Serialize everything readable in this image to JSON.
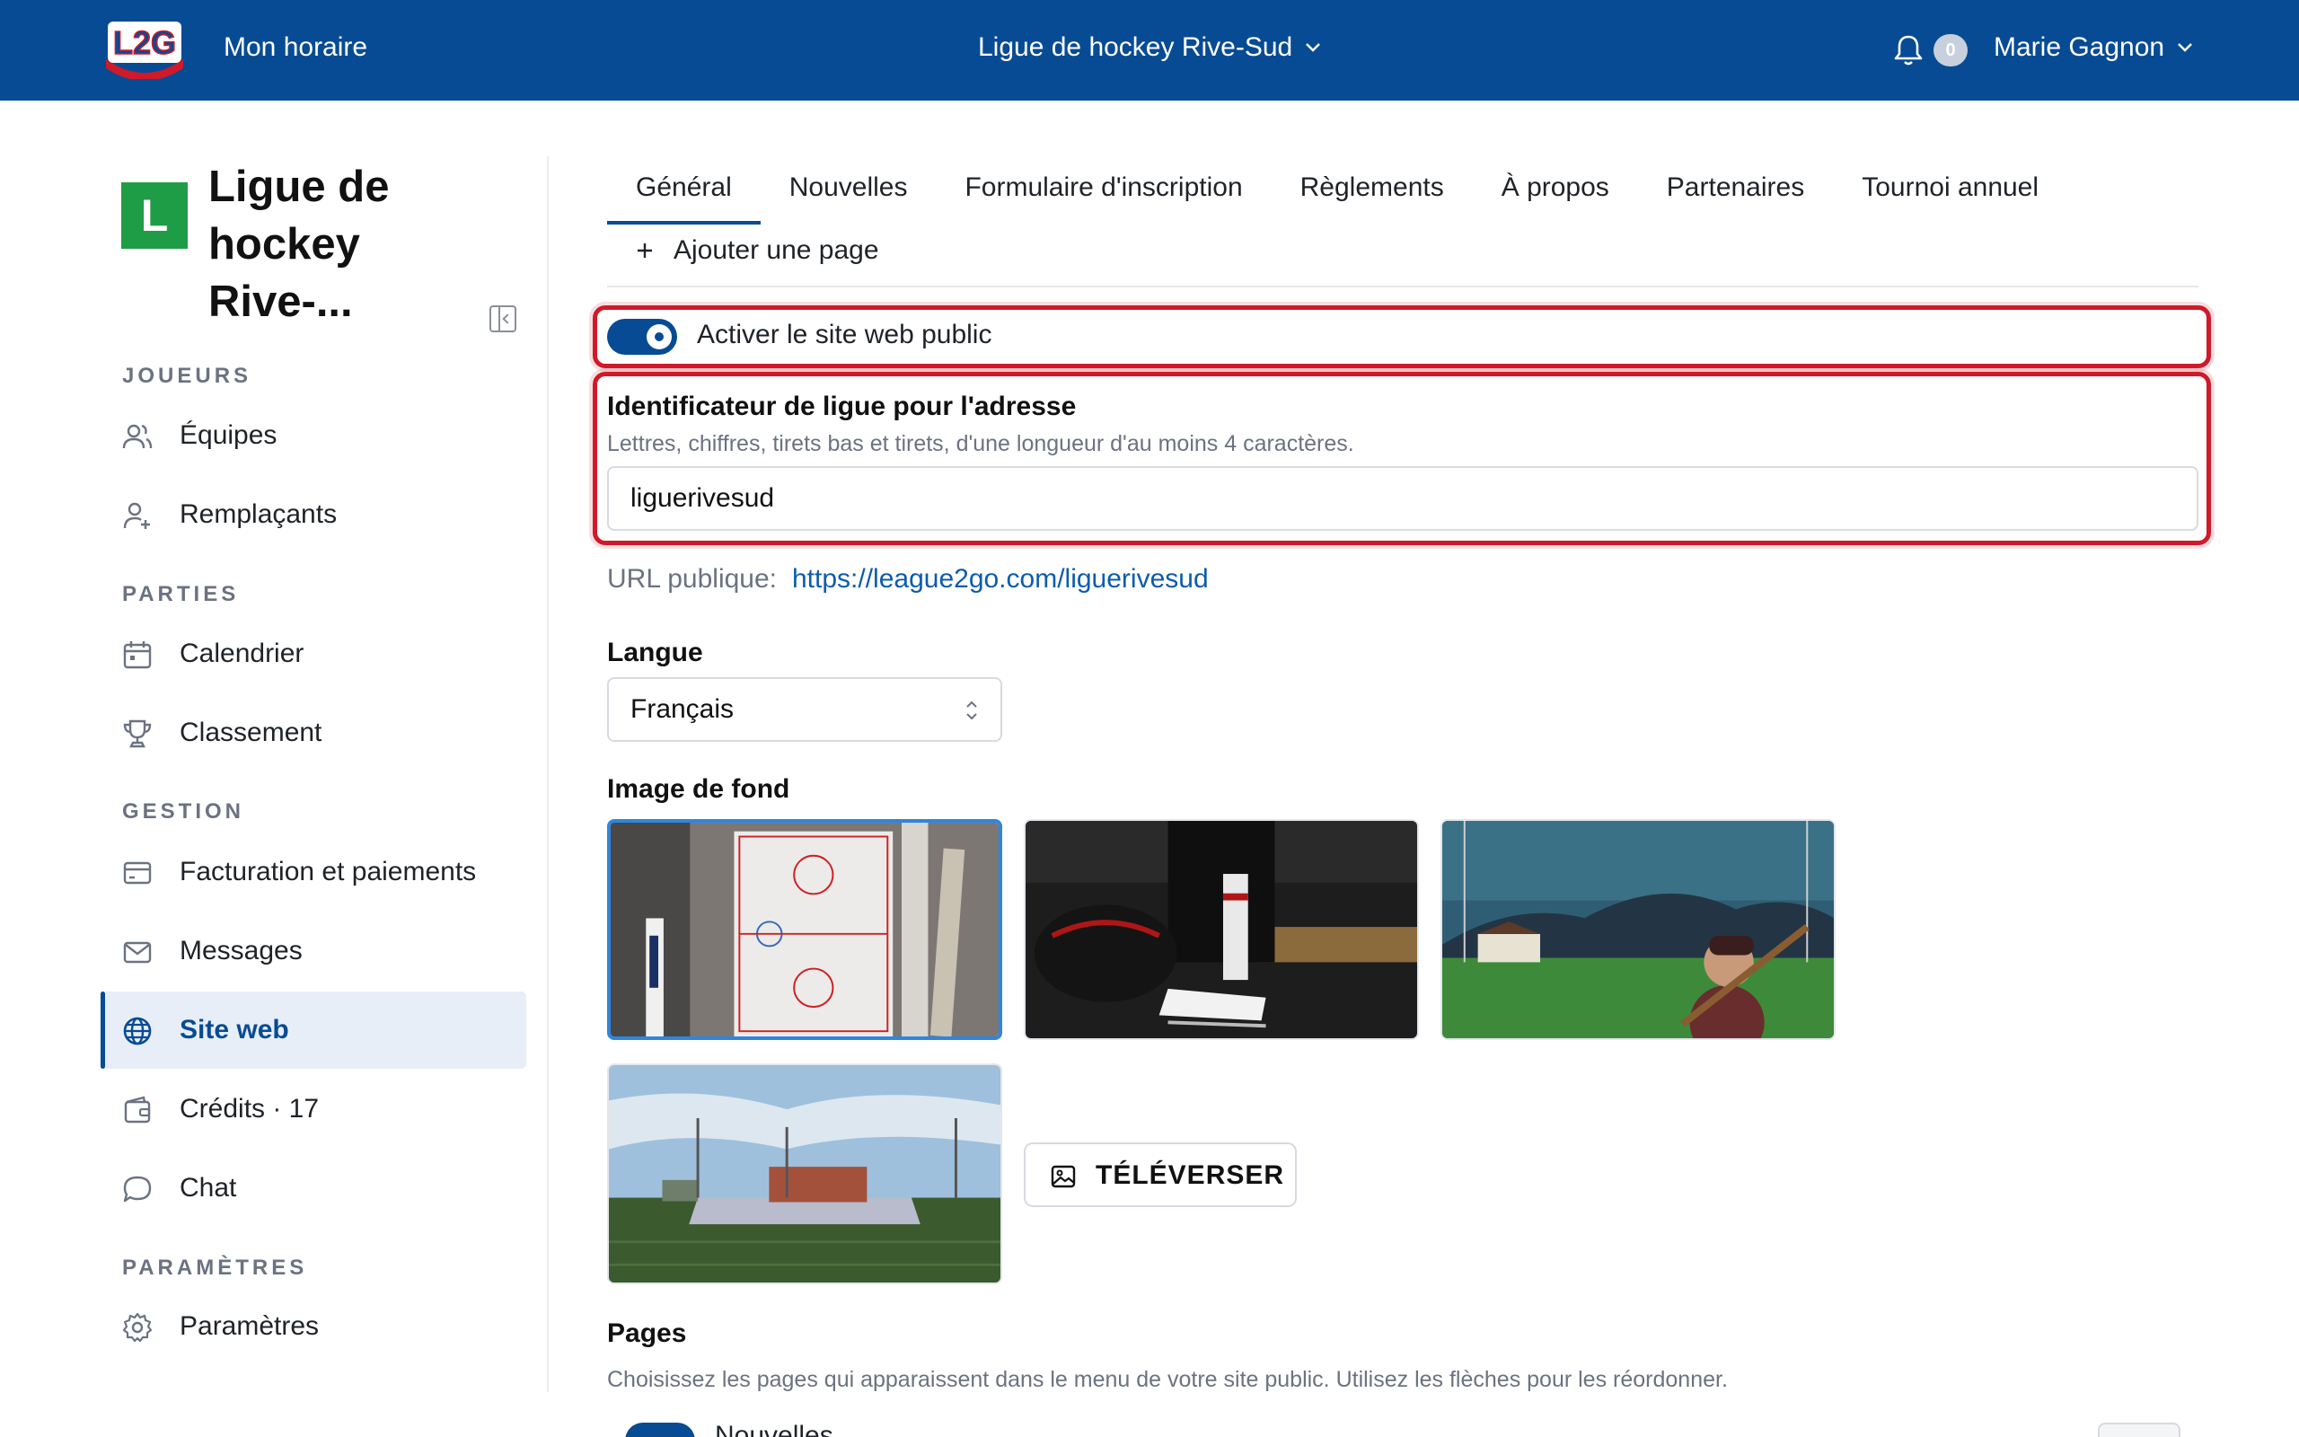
{
  "header": {
    "logo_text": "L2G",
    "my_schedule": "Mon horaire",
    "league_name": "Ligue de hockey Rive-Sud",
    "notification_count": "0",
    "user_name": "Marie Gagnon"
  },
  "sidebar": {
    "org_initial": "L",
    "org_name": "Ligue de hockey Rive-...",
    "sections": {
      "players": "JOUEURS",
      "games": "PARTIES",
      "management": "GESTION",
      "settings": "PARAMÈTRES"
    },
    "items": {
      "teams": "Équipes",
      "substitutes": "Remplaçants",
      "calendar": "Calendrier",
      "standings": "Classement",
      "billing": "Facturation et paiements",
      "messages": "Messages",
      "website": "Site web",
      "credits": "Crédits · 17",
      "chat": "Chat",
      "settings": "Paramètres"
    }
  },
  "tabs": [
    "Général",
    "Nouvelles",
    "Formulaire d'inscription",
    "Règlements",
    "À propos",
    "Partenaires",
    "Tournoi annuel"
  ],
  "add_page": "Ajouter une page",
  "public_site": {
    "toggle_label": "Activer le site web public",
    "enabled": true
  },
  "identifier": {
    "title": "Identificateur de ligue pour l'adresse",
    "help": "Lettres, chiffres, tirets bas et tirets, d'une longueur d'au moins 4 caractères.",
    "value": "liguerivesud"
  },
  "public_url": {
    "label": "URL publique:",
    "link": "https://league2go.com/liguerivesud"
  },
  "language": {
    "title": "Langue",
    "selected": "Français"
  },
  "background": {
    "title": "Image de fond",
    "upload_label": "TÉLÉVERSER"
  },
  "pages": {
    "title": "Pages",
    "help": "Choisissez les pages qui apparaissent dans le menu de votre site public. Utilisez les flèches pour les réordonner.",
    "first_item_partial": "Nouvelles"
  },
  "colors": {
    "brand": "#074b94",
    "highlight": "#d0192a",
    "link": "#0b5cad",
    "org_avatar": "#1f9d46"
  }
}
